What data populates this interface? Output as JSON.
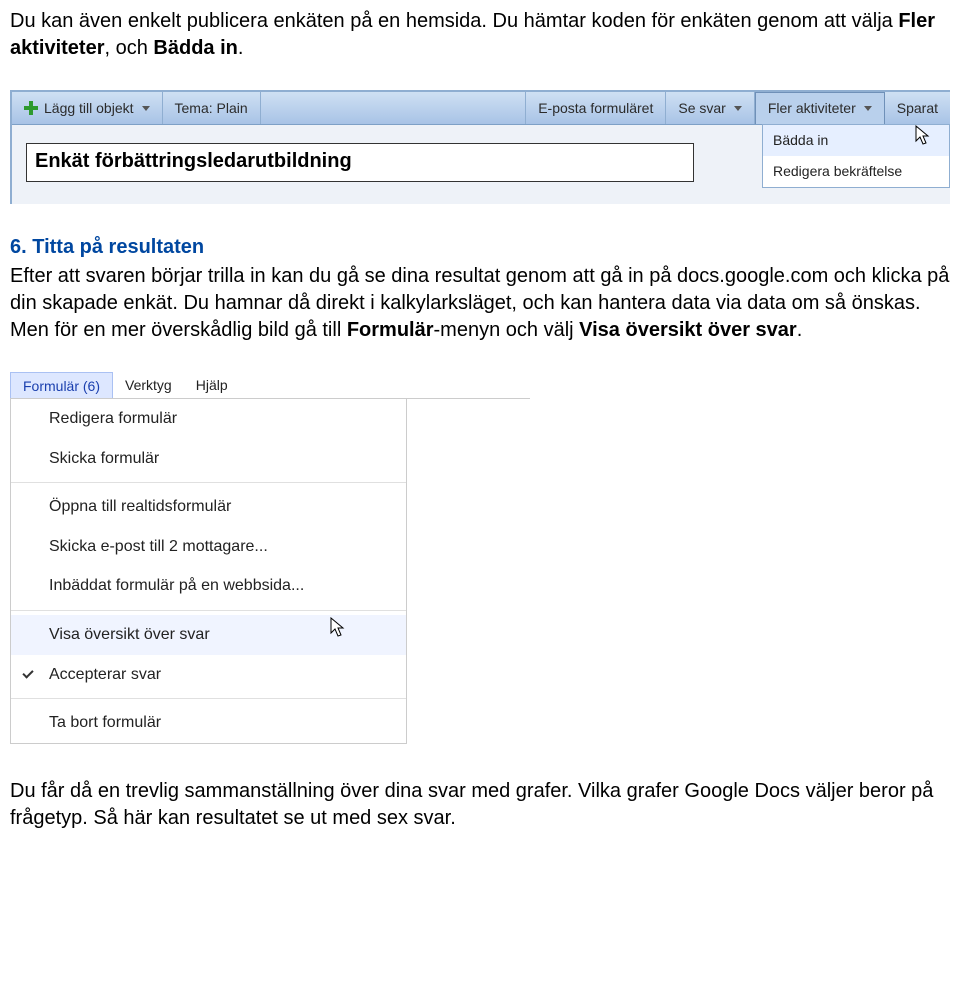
{
  "intro": {
    "text_a": "Du kan även enkelt publicera enkäten på en hemsida. Du hämtar koden för enkäten genom att välja ",
    "bold_a": "Fler aktiviteter",
    "text_b": ", och ",
    "bold_b": "Bädda in",
    "text_c": "."
  },
  "toolbar": {
    "add": "Lägg till objekt",
    "theme": "Tema: Plain",
    "email": "E-posta formuläret",
    "see": "Se svar",
    "more": "Fler aktiviteter",
    "saved": "Sparat",
    "dropdown": {
      "embed": "Bädda in",
      "confirm": "Redigera bekräftelse"
    },
    "title": "Enkät förbättringsledarutbildning"
  },
  "section6": {
    "heading": "6. Titta på resultaten",
    "body_a": "Efter att svaren börjar trilla in kan du gå se dina resultat genom att gå in på docs.google.com och klicka på din skapade enkät. Du hamnar då direkt i kalkylarksläget, och kan hantera data via data om så önskas. Men för en mer överskådlig bild gå till ",
    "bold_a": "Formulär",
    "body_b": "-menyn och välj ",
    "bold_b": "Visa översikt över svar",
    "body_c": "."
  },
  "menu": {
    "formular": "Formulär (6)",
    "verktyg": "Verktyg",
    "hjalp": "Hjälp",
    "items": {
      "redigera": "Redigera formulär",
      "skicka": "Skicka formulär",
      "oppna": "Öppna till realtidsformulär",
      "epost": "Skicka e-post till 2 mottagare...",
      "inbaddat": "Inbäddat formulär på en webbsida...",
      "visa": "Visa översikt över svar",
      "accepterar": "Accepterar svar",
      "tabort": "Ta bort formulär"
    }
  },
  "outro": {
    "text": "Du får då en trevlig sammanställning över dina svar med grafer. Vilka grafer Google Docs väljer beror på frågetyp. Så här kan resultatet se ut med sex svar."
  }
}
